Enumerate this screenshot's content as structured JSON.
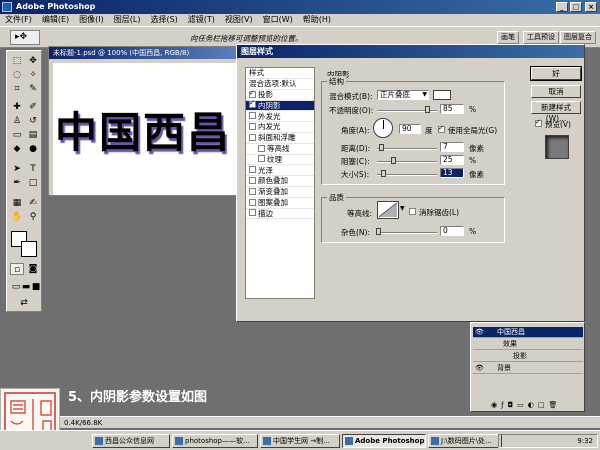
{
  "app": {
    "title": "Adobe Photoshop",
    "window_buttons": [
      "_",
      "□",
      "×"
    ]
  },
  "menu": [
    "文件(F)",
    "编辑(E)",
    "图像(I)",
    "图层(L)",
    "选择(S)",
    "滤镜(T)",
    "视图(V)",
    "窗口(W)",
    "帮助(H)"
  ],
  "options_bar": {
    "hint": "向任务栏拖移可调整预览的位置。",
    "tabs": [
      "画笔",
      "工具预设",
      "图层复合"
    ]
  },
  "document": {
    "title": "未标题-1.psd @ 100% (中国西昌, RGB/8)",
    "canvas_text": "中国西昌"
  },
  "dialog": {
    "title": "图层样式",
    "style_list_header": "样式",
    "blend_options": "混合选项:默认",
    "styles": [
      {
        "label": "投影",
        "checked": true,
        "selected": false,
        "indent": false
      },
      {
        "label": "内阴影",
        "checked": true,
        "selected": true,
        "indent": false
      },
      {
        "label": "外发光",
        "checked": false,
        "selected": false,
        "indent": false
      },
      {
        "label": "内发光",
        "checked": false,
        "selected": false,
        "indent": false
      },
      {
        "label": "斜面和浮雕",
        "checked": false,
        "selected": false,
        "indent": false
      },
      {
        "label": "等高线",
        "checked": false,
        "selected": false,
        "indent": true
      },
      {
        "label": "纹理",
        "checked": false,
        "selected": false,
        "indent": true
      },
      {
        "label": "光泽",
        "checked": false,
        "selected": false,
        "indent": false
      },
      {
        "label": "颜色叠加",
        "checked": false,
        "selected": false,
        "indent": false
      },
      {
        "label": "渐变叠加",
        "checked": false,
        "selected": false,
        "indent": false
      },
      {
        "label": "图案叠加",
        "checked": false,
        "selected": false,
        "indent": false
      },
      {
        "label": "描边",
        "checked": false,
        "selected": false,
        "indent": false
      }
    ],
    "section_title": "内阴影",
    "structure": {
      "group_label": "结构",
      "blend_mode_label": "混合模式(B):",
      "blend_mode_value": "正片叠底",
      "opacity_label": "不透明度(O):",
      "opacity_value": "85",
      "opacity_unit": "%",
      "opacity_level": 0.85,
      "angle_label": "角度(A):",
      "angle_value": "90",
      "angle_unit": "度",
      "global_light_label": "使用全局光(G)",
      "distance_label": "距离(D):",
      "distance_value": "7",
      "distance_unit": "像素",
      "choke_label": "阻塞(C):",
      "choke_value": "25",
      "choke_unit": "%",
      "size_label": "大小(S):",
      "size_value": "13",
      "size_unit": "像素"
    },
    "quality": {
      "group_label": "品质",
      "contour_label": "等高线:",
      "antialias_label": "消除锯齿(L)",
      "noise_label": "杂色(N):",
      "noise_value": "0",
      "noise_unit": "%"
    },
    "buttons": {
      "ok": "好",
      "cancel": "取消",
      "new_style": "新建样式(W)...",
      "preview": "预览(V)"
    }
  },
  "layers": {
    "rows": [
      {
        "name": "中国西昌",
        "selected": true,
        "kind": "text"
      },
      {
        "name": "效果",
        "selected": false,
        "kind": "effects"
      },
      {
        "name": "投影",
        "selected": false,
        "kind": "effect"
      },
      {
        "name": "背景",
        "selected": false,
        "kind": "background"
      }
    ]
  },
  "caption": "5、内阴影参数设置如图",
  "status_text": "0.4K/66.8K",
  "taskbar": {
    "items": [
      {
        "label": "西昌公众信息网",
        "active": false
      },
      {
        "label": "photoshop——软...",
        "active": false
      },
      {
        "label": "中国学生网 →制...",
        "active": false
      },
      {
        "label": "Adobe Photoshop",
        "active": true
      },
      {
        "label": "J:\\数码图片\\处...",
        "active": false
      }
    ],
    "clock": "9:32"
  }
}
